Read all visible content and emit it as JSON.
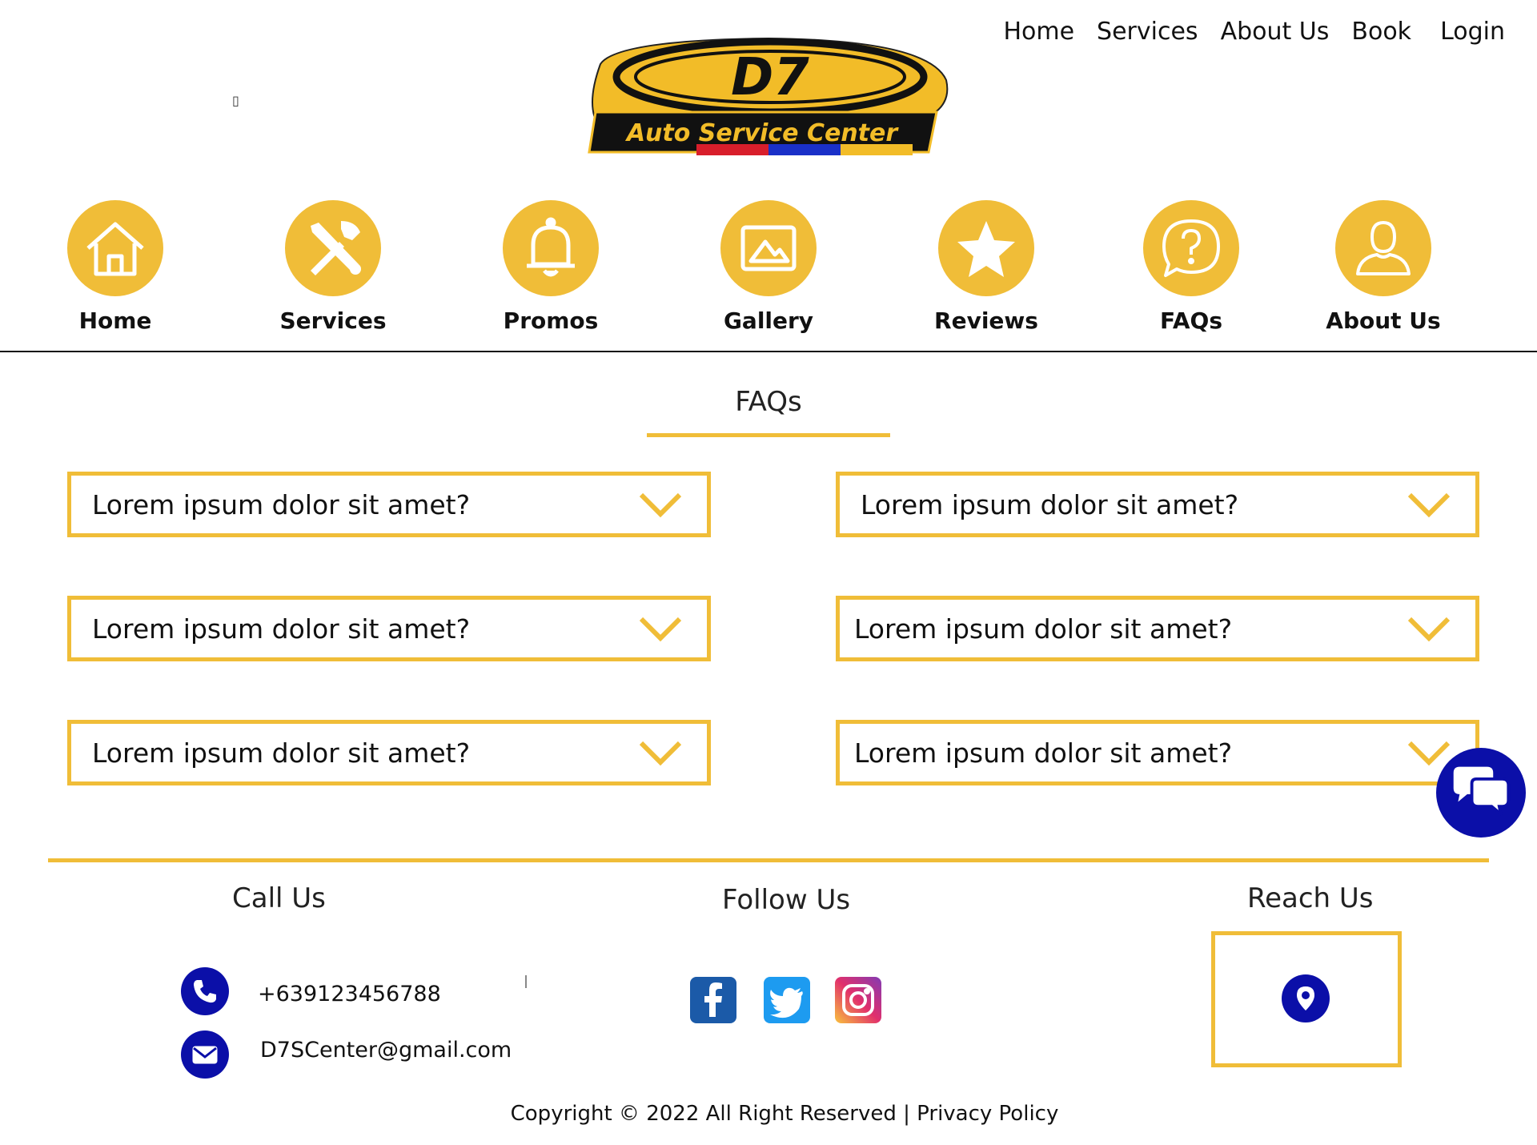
{
  "top_nav": {
    "items": [
      "Home",
      "Services",
      "About Us",
      "Book",
      "Login"
    ]
  },
  "logo": {
    "mark": "D7",
    "tagline": "Auto Service Center"
  },
  "stray_glyph": "▯",
  "icon_nav": {
    "items": [
      {
        "label": "Home",
        "icon": "home-icon"
      },
      {
        "label": "Services",
        "icon": "tools-icon"
      },
      {
        "label": "Promos",
        "icon": "bell-icon"
      },
      {
        "label": "Gallery",
        "icon": "image-icon"
      },
      {
        "label": "Reviews",
        "icon": "star-icon"
      },
      {
        "label": "FAQs",
        "icon": "question-bubble-icon"
      },
      {
        "label": "About Us",
        "icon": "user-icon"
      }
    ]
  },
  "faq": {
    "title": "FAQs",
    "questions": [
      "Lorem ipsum dolor sit amet?",
      "Lorem ipsum dolor sit amet?",
      "Lorem ipsum dolor sit amet?",
      "Lorem ipsum dolor sit amet?",
      "Lorem ipsum dolor sit amet?",
      "Lorem ipsum dolor sit amet?"
    ]
  },
  "footer": {
    "call_us": {
      "heading": "Call Us",
      "phone": "+639123456788",
      "email": "D7SCenter@gmail.com"
    },
    "follow_us": {
      "heading": "Follow Us",
      "networks": [
        "facebook-icon",
        "twitter-icon",
        "instagram-icon"
      ]
    },
    "reach_us": {
      "heading": "Reach Us",
      "icon": "location-pin-icon"
    },
    "copyright": "Copyright © 2022 All Right Reserved | Privacy Policy"
  },
  "colors": {
    "accent": "#f0bd38",
    "brand_blue": "#0b0fa8",
    "text": "#111111"
  }
}
